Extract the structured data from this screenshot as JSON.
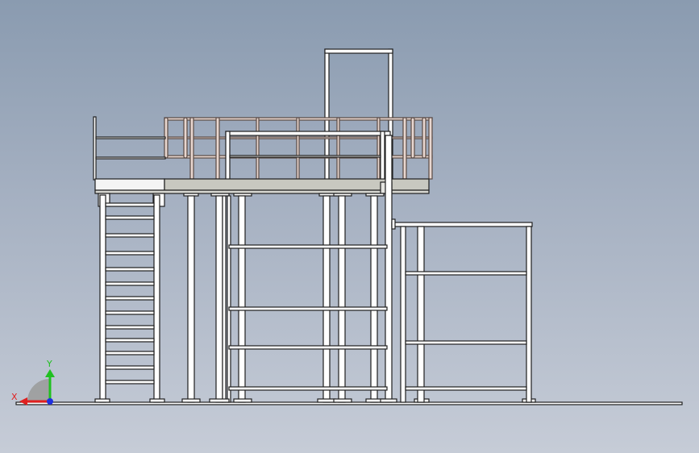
{
  "viewport": {
    "background_top": "#8a9bb0",
    "background_bottom": "#c6ccd7"
  },
  "model": {
    "line_color": "#1e1e1e",
    "pipe_fill": "#ffffff",
    "deck_fill": "#c8c8c0",
    "railing_tint": "#d9bfb3"
  },
  "triad": {
    "x_label": "X",
    "y_label": "Y",
    "x_color": "#e02020",
    "y_color": "#20c020",
    "z_color": "#2030e0"
  }
}
